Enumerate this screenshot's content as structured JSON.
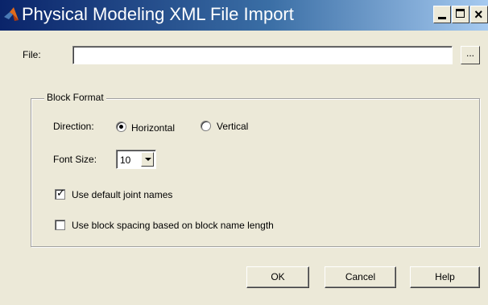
{
  "window": {
    "title": "Physical Modeling XML File Import",
    "icon": "matlab-icon",
    "controls": {
      "minimize": "minimize-icon",
      "maximize": "maximize-icon",
      "close": "close-icon"
    }
  },
  "file": {
    "label": "File:",
    "value": "",
    "browse_label": "..."
  },
  "block_format": {
    "legend": "Block Format",
    "direction": {
      "label": "Direction:",
      "options": [
        {
          "label": "Horizontal",
          "selected": true
        },
        {
          "label": "Vertical",
          "selected": false
        }
      ]
    },
    "font_size": {
      "label": "Font Size:",
      "selected": "10"
    },
    "checkboxes": [
      {
        "label": "Use default joint names",
        "checked": true
      },
      {
        "label": "Use block spacing based on block name length",
        "checked": false
      }
    ]
  },
  "buttons": {
    "ok": "OK",
    "cancel": "Cancel",
    "help": "Help"
  },
  "colors": {
    "title_start": "#0a246a",
    "title_end": "#a6caf0",
    "face": "#ece9d8"
  }
}
